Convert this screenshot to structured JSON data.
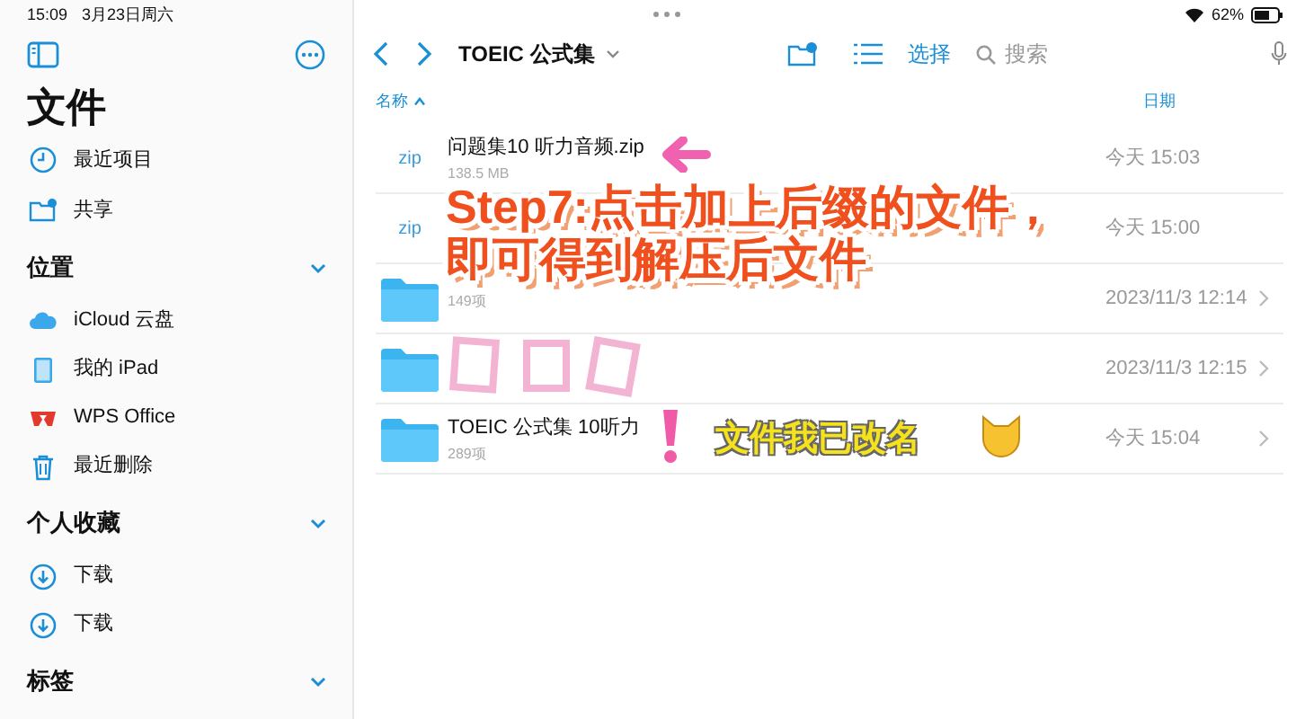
{
  "status_bar": {
    "time": "15:09",
    "date": "3月23日周六",
    "battery": "62%"
  },
  "sidebar": {
    "title": "文件",
    "top_items": [
      {
        "kind": "clock",
        "label": "最近项目"
      },
      {
        "kind": "shared",
        "label": "共享"
      }
    ],
    "sections": [
      {
        "title": "位置",
        "expanded": true,
        "items": [
          {
            "kind": "cloud",
            "label": "iCloud 云盘"
          },
          {
            "kind": "ipad",
            "label": "我的 iPad"
          },
          {
            "kind": "wps",
            "label": "WPS Office"
          },
          {
            "kind": "trash",
            "label": "最近删除"
          }
        ]
      },
      {
        "title": "个人收藏",
        "expanded": true,
        "items": [
          {
            "kind": "download",
            "label": "下载"
          },
          {
            "kind": "download",
            "label": "下载"
          }
        ]
      },
      {
        "title": "标签",
        "expanded": true
      }
    ]
  },
  "toolbar": {
    "title": "TOEIC 公式集",
    "select": "选择",
    "search_placeholder": "搜索"
  },
  "columns": {
    "name": "名称",
    "date": "日期"
  },
  "rows": [
    {
      "kind": "zip",
      "icon_text": "zip",
      "name": "问题集10 听力音频.zip",
      "info": "138.5 MB",
      "date": "今天 15:03"
    },
    {
      "kind": "zip",
      "icon_text": "zip",
      "date": "今天 15:00"
    },
    {
      "kind": "folder",
      "info": "149项",
      "date": "2023/11/3 12:14"
    },
    {
      "kind": "folder",
      "date": "2023/11/3 12:15"
    },
    {
      "kind": "folder",
      "name": "TOEIC 公式集 10听力",
      "info": "289项",
      "date": "今天 15:04"
    }
  ],
  "annotations": {
    "caption": [
      "Step7:点击加上后缀的文件，",
      "即可得到解压后文件"
    ],
    "note": "文件我已改名"
  }
}
